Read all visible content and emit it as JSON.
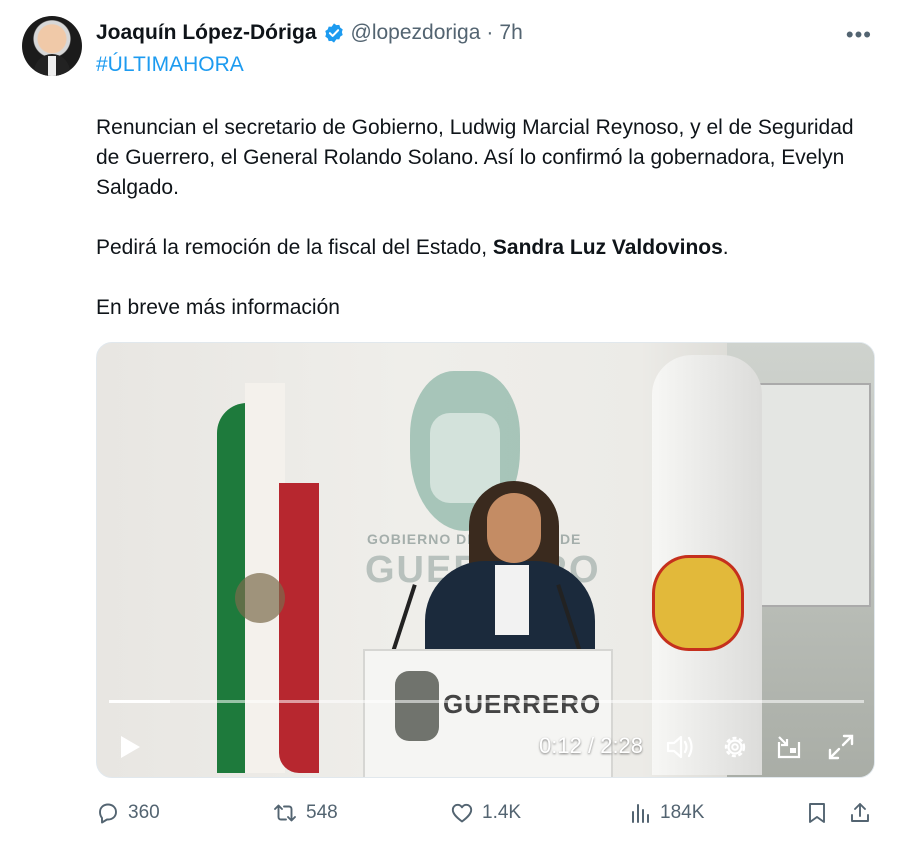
{
  "tweet": {
    "author_name": "Joaquín López-Dóriga",
    "handle": "@lopezdoriga",
    "separator": "·",
    "time": "7h",
    "more_label": "•••",
    "hashtag": "#ÚLTIMAHORA",
    "paragraph1": "Renuncian el secretario de Gobierno, Ludwig Marcial Reynoso, y el de Seguridad de Guerrero, el General Rolando Solano. Así lo confirmó la gobernadora, Evelyn Salgado.",
    "paragraph2_prefix": "Pedirá la remoción de la fiscal del Estado, ",
    "paragraph2_bold": "Sandra Luz Valdovinos",
    "paragraph2_suffix": ".",
    "paragraph3": "En breve más información"
  },
  "video": {
    "wall_text_line1": "GOBIERNO DEL ESTADO DE",
    "wall_text_line2": "GUERRERO",
    "podium_text": "GUERRERO",
    "current_time": "0:12",
    "time_separator": "/",
    "duration": "2:28",
    "progress_fraction": 0.081
  },
  "actions": {
    "replies": "360",
    "reposts": "548",
    "likes": "1.4K",
    "views": "184K"
  },
  "icons": [
    "verified-badge-icon",
    "more-icon",
    "play-icon",
    "volume-icon",
    "settings-gear-icon",
    "dock-icon",
    "fullscreen-icon",
    "reply-icon",
    "repost-icon",
    "like-icon",
    "views-icon",
    "bookmark-icon",
    "share-icon"
  ],
  "colors": {
    "accent": "#1d9bf0",
    "muted": "#536471",
    "text": "#0f1419"
  }
}
